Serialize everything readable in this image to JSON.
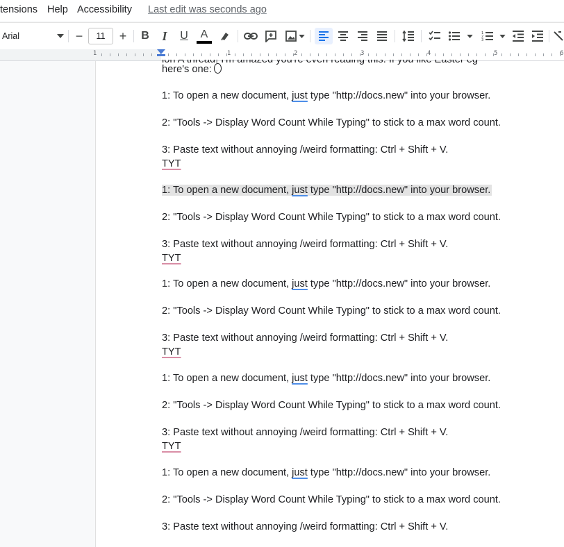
{
  "menubar": {
    "items": [
      "tensions",
      "Help",
      "Accessibility"
    ],
    "last_edit": "Last edit was seconds ago"
  },
  "toolbar": {
    "font": "Arial",
    "font_size": "11",
    "decrease_label": "−",
    "increase_label": "+",
    "bold_label": "B",
    "italic_label": "I",
    "underline_label": "U",
    "text_color_label": "A",
    "text_color": "#000000"
  },
  "ruler": {
    "labels": [
      "1",
      "1",
      "2",
      "3",
      "4",
      "5",
      "6"
    ]
  },
  "doc": {
    "top_line": "ion A thread! I'm amazed you're even reading this. If you like Easter eg",
    "top_line2": "here's one:",
    "lines": [
      {
        "pre": "1: To open a new document, ",
        "sp": "just",
        "post": " type \"http://docs.new\" into your browser."
      },
      {
        "text": "2: \"Tools -> Display Word Count While Typing\" to stick to a max word count."
      },
      {
        "text": "3: Paste text without annoying /weird formatting: Ctrl + Shift + V."
      },
      {
        "red": "TYT"
      },
      {
        "pre": "1: To open a new document, ",
        "sp": "just",
        "post": " type \"http://docs.new\" into your browser."
      },
      {
        "text": "2: \"Tools -> Display Word Count While Typing\" to stick to a max word count."
      },
      {
        "text": "3: Paste text without annoying /weird formatting: Ctrl + Shift + V."
      },
      {
        "red": "TYT"
      },
      {
        "pre": "1: To open a new document, ",
        "sp": "just",
        "post": " type \"http://docs.new\" into your browser."
      },
      {
        "text": "2: \"Tools -> Display Word Count While Typing\" to stick to a max word count."
      },
      {
        "text": "3: Paste text without annoying /weird formatting: Ctrl + Shift + V."
      },
      {
        "red": "TYT"
      },
      {
        "pre": "1: To open a new document, ",
        "sp": "just",
        "post": " type \"http://docs.new\" into your browser."
      },
      {
        "text": "2: \"Tools -> Display Word Count While Typing\" to stick to a max word count."
      },
      {
        "text": "3: Paste text without annoying /weird formatting: Ctrl + Shift + V."
      },
      {
        "red": "TYT"
      },
      {
        "pre": "1: To open a new document, ",
        "sp": "just",
        "post": " type \"http://docs.new\" into your browser."
      },
      {
        "text": "2: \"Tools -> Display Word Count While Typing\" to stick to a max word count."
      },
      {
        "text": "3: Paste text without annoying /weird formatting: Ctrl + Shift + V."
      }
    ]
  },
  "colors": {
    "accent": "#1a73e8",
    "highlight": "#e3e3e3",
    "spell_blue": "#4e8ee8",
    "spell_red": "#d98ea6"
  }
}
